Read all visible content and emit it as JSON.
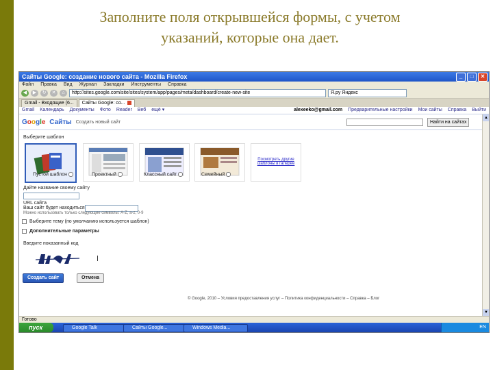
{
  "slide": {
    "title_line1": "Заполните поля открывшейся формы, с учетом",
    "title_line2": "указаний, которые она дает."
  },
  "browser": {
    "window_title": "Сайты Google: создание нового сайта - Mozilla Firefox",
    "menu": [
      "Файл",
      "Правка",
      "Вид",
      "Журнал",
      "Закладки",
      "Инструменты",
      "Справка"
    ],
    "url": "http://sites.google.com/site/sites/system/app/pages/meta/dashboard/create-new-site",
    "search_placeholder": "Я.ру Яндекс",
    "tabs": [
      {
        "label": "Gmail - Входящие (6..."
      },
      {
        "label": "Сайты Google: со..."
      }
    ],
    "status": "Готово"
  },
  "google_bar": {
    "links": [
      "Gmail",
      "Календарь",
      "Документы",
      "Фото",
      "Reader",
      "Веб",
      "ещё ▾"
    ],
    "email": "alexeeko@gmail.com",
    "right_links": [
      "Предварительные настройки",
      "Мои сайты",
      "Справка",
      "Выйти"
    ]
  },
  "header": {
    "logo_google": "Google",
    "logo_sites": "Сайты",
    "subtitle": "Создать новый сайт",
    "search_button": "Найти на сайтах"
  },
  "form": {
    "template_heading": "Выберите шаблон",
    "templates": [
      {
        "caption": "Пустой шаблон"
      },
      {
        "caption": "Проектный"
      },
      {
        "caption": "Классный сайт"
      },
      {
        "caption": "Семейный"
      },
      {
        "caption": "Посмотреть другие шаблоны в галерее"
      }
    ],
    "site_name_label": "Дайте название своему сайту",
    "site_url_label": "URL сайта",
    "site_url_hint": "Ваш сайт будет находиться по адресу:",
    "site_url_note": "Можно использовать только следующие символы: A-Z, a-z, 0-9",
    "theme_row": "Выберите тему (по умолчанию используется шаблон)",
    "more_row": "Дополнительные параметры",
    "captcha_label": "Введите показанный код",
    "create_button": "Создать сайт",
    "cancel_button": "Отмена",
    "footer": "© Google, 2010 – Условия предоставления услуг – Политика конфиденциальности – Справка – Блог"
  },
  "taskbar": {
    "start": "пуск",
    "tasks": [
      "Google Talk",
      "Сайты Google...",
      "Windows Media..."
    ],
    "tray_text": "EN"
  },
  "colors": {
    "left_bar": "#7a7a0a",
    "title_text": "#8a7a2a",
    "accent_blue": "#2f5cb8"
  }
}
